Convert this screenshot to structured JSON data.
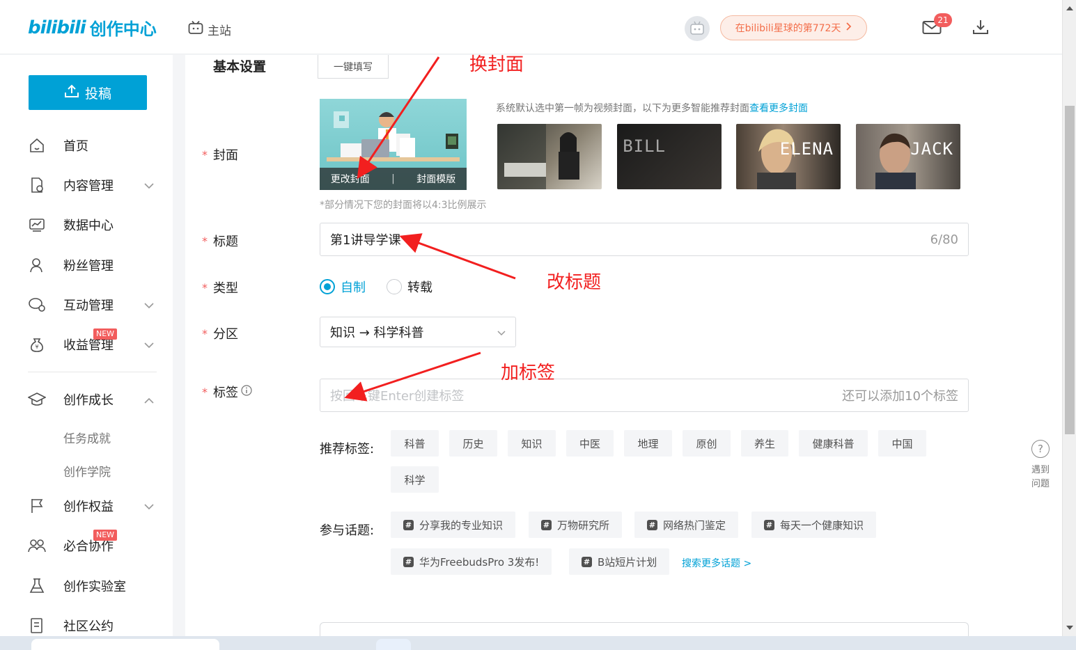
{
  "header": {
    "brand": "bilibili",
    "brand_sub": "创作中心",
    "main_site": "主站",
    "planet_text": "在bilibili星球的第772天",
    "mail_badge": "21"
  },
  "sidebar": {
    "upload_label": "投稿",
    "items": [
      {
        "label": "首页",
        "icon": "home-icon"
      },
      {
        "label": "内容管理",
        "icon": "content-icon"
      },
      {
        "label": "数据中心",
        "icon": "chart-icon"
      },
      {
        "label": "粉丝管理",
        "icon": "user-icon"
      },
      {
        "label": "互动管理",
        "icon": "chat-icon"
      },
      {
        "label": "收益管理",
        "icon": "money-bag-icon",
        "badge": "NEW"
      },
      {
        "label": "创作成长",
        "icon": "graduation-cap-icon"
      },
      {
        "label": "创作权益",
        "icon": "flag-icon"
      },
      {
        "label": "必合协作",
        "icon": "people-icon",
        "badge": "NEW"
      },
      {
        "label": "创作实验室",
        "icon": "flask-icon"
      },
      {
        "label": "社区公约",
        "icon": "document-icon"
      }
    ],
    "sub_items": [
      "任务成就",
      "创作学院"
    ]
  },
  "form": {
    "section_title": "基本设置",
    "fill_button": "一键填写",
    "required_mark": "*",
    "cover": {
      "label": "封面",
      "change_cover": "更改封面",
      "cover_template": "封面模版",
      "hint": "*部分情况下您的封面将以4:3比例展示",
      "recommend_text": "系统默认选中第一帧为视频封面，以下为更多智能推荐封面",
      "more_link": "查看更多封面",
      "thumbs": [
        {
          "text": ""
        },
        {
          "text": "BILL"
        },
        {
          "text": "ELENA"
        },
        {
          "text": "JACK"
        }
      ]
    },
    "title": {
      "label": "标题",
      "value": "第1讲导学课",
      "counter": "6/80"
    },
    "type": {
      "label": "类型",
      "options": [
        "自制",
        "转载"
      ],
      "selected": "自制"
    },
    "category": {
      "label": "分区",
      "value": "知识 → 科学科普"
    },
    "tags": {
      "label": "标签",
      "placeholder": "按回车键Enter创建标签",
      "remaining": "还可以添加10个标签",
      "recommend_label": "推荐标签:",
      "recommended": [
        "科普",
        "历史",
        "知识",
        "中医",
        "地理",
        "原创",
        "养生",
        "健康科普",
        "中国",
        "科学"
      ],
      "topics_label": "参与话题:",
      "topics": [
        "分享我的专业知识",
        "万物研究所",
        "网络热门鉴定",
        "每天一个健康知识",
        "华为FreebudsPro 3发布!",
        "B站短片计划"
      ],
      "more_topics": "搜索更多话题 >"
    }
  },
  "annotations": {
    "cover": "换封面",
    "title": "改标题",
    "tags": "加标签",
    "color": "#f21f1f"
  },
  "help": {
    "label_line1": "遇到",
    "label_line2": "问题"
  },
  "colors": {
    "accent": "#00a1d6",
    "danger": "#f25d5d"
  }
}
